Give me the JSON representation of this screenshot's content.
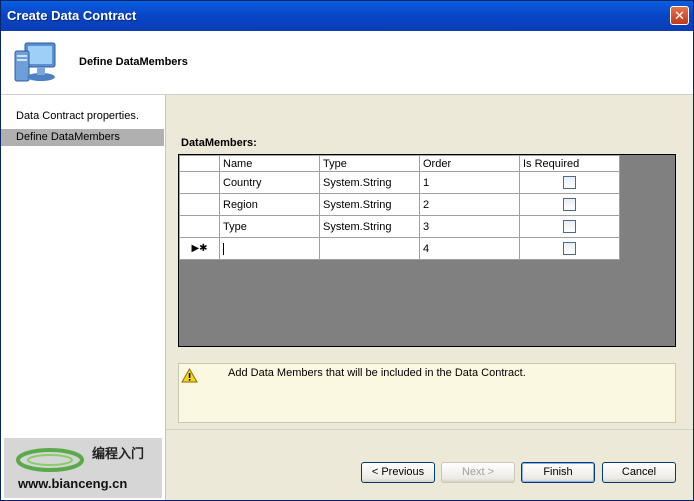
{
  "window": {
    "title": "Create Data Contract",
    "close_glyph": "✕"
  },
  "header": {
    "title": "Define DataMembers",
    "icon": "computer-icon"
  },
  "sidebar": {
    "items": [
      {
        "label": "Data Contract properties."
      },
      {
        "label": "Define DataMembers"
      }
    ]
  },
  "watermark": {
    "text_cn": "编程入门",
    "url": "www.bianceng.cn"
  },
  "main": {
    "section_label": "DataMembers:",
    "columns": [
      "Name",
      "Type",
      "Order",
      "Is Required"
    ],
    "rows": [
      {
        "name": "Country",
        "type": "System.String",
        "order": "1",
        "is_required": false
      },
      {
        "name": "Region",
        "type": "System.String",
        "order": "2",
        "is_required": false
      },
      {
        "name": "Type",
        "type": "System.String",
        "order": "3",
        "is_required": false
      }
    ],
    "new_row": {
      "marker": "▶✱",
      "name": "",
      "type": "",
      "order": "4",
      "is_required": false
    },
    "info_message": "Add Data Members that will be included in the Data Contract."
  },
  "buttons": {
    "previous": "< Previous",
    "next": "Next >",
    "finish": "Finish",
    "cancel": "Cancel"
  }
}
